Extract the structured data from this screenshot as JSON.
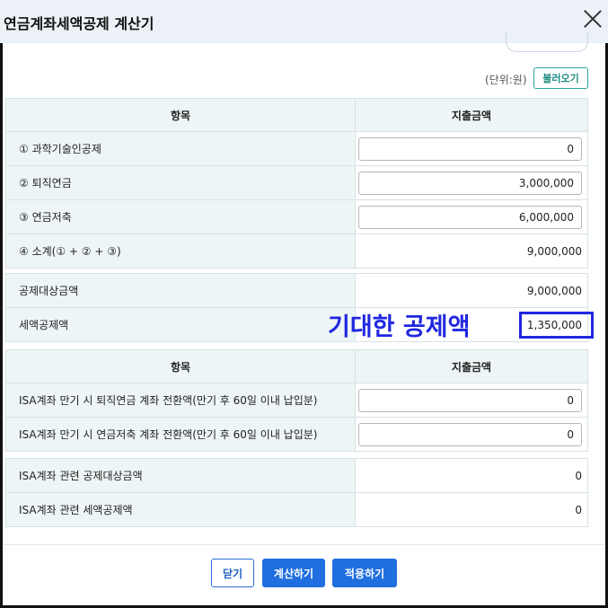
{
  "dialog": {
    "title": "연금계좌세액공제 계산기"
  },
  "unit_label": "(단위:원)",
  "load_button": "불러오기",
  "table1": {
    "headers": [
      "항목",
      "지출금액"
    ],
    "rows": [
      {
        "label": "① 과학기술인공제",
        "value": "0"
      },
      {
        "label": "② 퇴직연금",
        "value": "3,000,000"
      },
      {
        "label": "③ 연금저축",
        "value": "6,000,000"
      },
      {
        "label": "④ 소계(① + ② + ③)",
        "value": "9,000,000"
      }
    ]
  },
  "table2": {
    "rows": [
      {
        "label": "공제대상금액",
        "value": "9,000,000"
      },
      {
        "label": "세액공제액",
        "value": "1,350,000"
      }
    ]
  },
  "annotation": {
    "text": "기대한 공제액",
    "color": "#1f27e0"
  },
  "table3": {
    "headers": [
      "항목",
      "지출금액"
    ],
    "rows": [
      {
        "label": "ISA계좌 만기 시 퇴직연금 계좌 전환액(만기 후 60일 이내 납입분)",
        "value": "0"
      },
      {
        "label": "ISA계좌 만기 시 연금저축 계좌 전환액(만기 후 60일 이내 납입분)",
        "value": "0"
      }
    ]
  },
  "table4": {
    "rows": [
      {
        "label": "ISA계좌 관련 공제대상금액",
        "value": "0"
      },
      {
        "label": "ISA계좌 관련 세액공제액",
        "value": "0"
      }
    ]
  },
  "footer": {
    "close": "닫기",
    "calculate": "계산하기",
    "apply": "적용하기"
  },
  "colors": {
    "primary": "#1f6fe0",
    "teal": "#27a39a",
    "header_bg": "#eef5f6"
  }
}
